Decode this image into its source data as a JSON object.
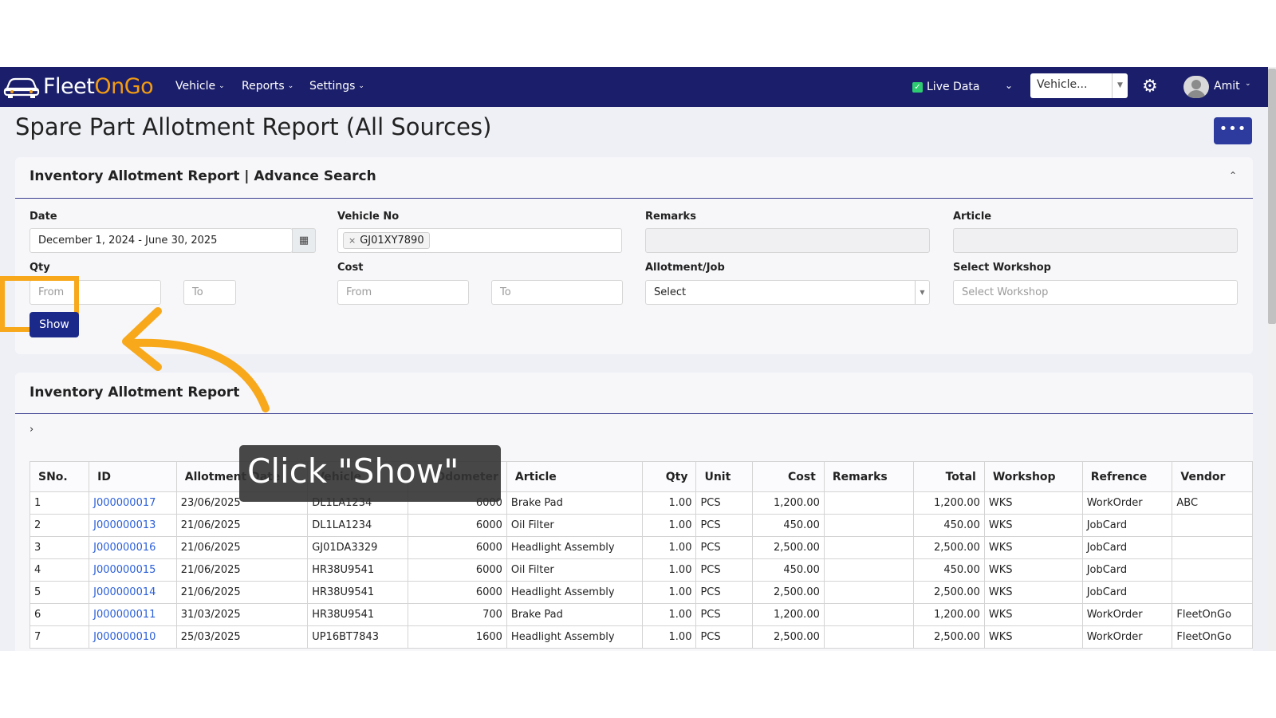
{
  "navbar": {
    "brand_part1": "Fleet",
    "brand_part2": "OnGo",
    "menus": [
      {
        "label": "Vehicle"
      },
      {
        "label": "Reports"
      },
      {
        "label": "Settings"
      }
    ],
    "live_data_label": "Live Data",
    "vehicle_select_placeholder": "Vehicle...",
    "user_name": "Amit",
    "icons": {
      "settings": "gear-icon",
      "avatar": "user-avatar-icon",
      "logo": "car-logo-icon"
    }
  },
  "page": {
    "title": "Spare Part Allotment Report (All Sources)",
    "more_button_label": "•••"
  },
  "search": {
    "title": "Inventory Allotment Report | Advance Search",
    "fields": {
      "date_label": "Date",
      "date_value": "December 1, 2024 - June 30, 2025",
      "vehicle_label": "Vehicle No",
      "vehicle_tag": "GJ01XY7890",
      "remarks_label": "Remarks",
      "article_label": "Article",
      "qty_label": "Qty",
      "qty_from_placeholder": "From",
      "qty_to_placeholder": "To",
      "cost_label": "Cost",
      "cost_from_placeholder": "From",
      "cost_to_placeholder": "To",
      "allotment_label": "Allotment/Job",
      "allotment_value": "Select",
      "workshop_label": "Select Workshop",
      "workshop_placeholder": "Select Workshop"
    },
    "show_button_label": "Show"
  },
  "report": {
    "title": "Inventory Allotment Report",
    "expand_symbol": "›",
    "columns": [
      "SNo.",
      "ID",
      "Allotment Date",
      "Vehicle",
      "Odometer",
      "Article",
      "Qty",
      "Unit",
      "Cost",
      "Remarks",
      "Total",
      "Workshop",
      "Refrence",
      "Vendor"
    ],
    "rows": [
      [
        "1",
        "J000000017",
        "23/06/2025",
        "DL1LA1234",
        "6000",
        "Brake Pad",
        "1.00",
        "PCS",
        "1,200.00",
        "",
        "1,200.00",
        "WKS",
        "WorkOrder",
        "ABC"
      ],
      [
        "2",
        "J000000013",
        "21/06/2025",
        "DL1LA1234",
        "6000",
        "Oil Filter",
        "1.00",
        "PCS",
        "450.00",
        "",
        "450.00",
        "WKS",
        "JobCard",
        ""
      ],
      [
        "3",
        "J000000016",
        "21/06/2025",
        "GJ01DA3329",
        "6000",
        "Headlight Assembly",
        "1.00",
        "PCS",
        "2,500.00",
        "",
        "2,500.00",
        "WKS",
        "JobCard",
        ""
      ],
      [
        "4",
        "J000000015",
        "21/06/2025",
        "HR38U9541",
        "6000",
        "Oil Filter",
        "1.00",
        "PCS",
        "450.00",
        "",
        "450.00",
        "WKS",
        "JobCard",
        ""
      ],
      [
        "5",
        "J000000014",
        "21/06/2025",
        "HR38U9541",
        "6000",
        "Headlight Assembly",
        "1.00",
        "PCS",
        "2,500.00",
        "",
        "2,500.00",
        "WKS",
        "JobCard",
        ""
      ],
      [
        "6",
        "J000000011",
        "31/03/2025",
        "HR38U9541",
        "700",
        "Brake Pad",
        "1.00",
        "PCS",
        "1,200.00",
        "",
        "1,200.00",
        "WKS",
        "WorkOrder",
        "FleetOnGo"
      ],
      [
        "7",
        "J000000010",
        "25/03/2025",
        "UP16BT7843",
        "1600",
        "Headlight Assembly",
        "1.00",
        "PCS",
        "2,500.00",
        "",
        "2,500.00",
        "WKS",
        "WorkOrder",
        "FleetOnGo"
      ]
    ]
  },
  "annotation": {
    "tooltip_text": "Click \"Show\"",
    "highlight_color": "#f7a81b"
  },
  "colors": {
    "navbar": "#1b1f6b",
    "brand_accent": "#f39c12",
    "primary_button": "#1b2a8a",
    "link": "#2b5fd9"
  }
}
